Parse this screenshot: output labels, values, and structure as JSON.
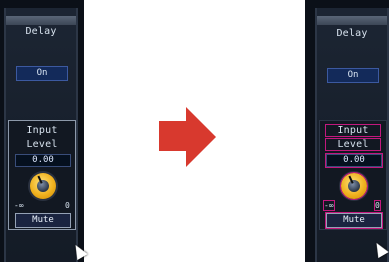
{
  "left_panel": {
    "section_title": "Delay",
    "delay_button": "On",
    "input_label_1": "Input",
    "input_label_2": "Level",
    "value": "0.00",
    "scale_min": "-∞",
    "scale_max": "0",
    "mute_button": "Mute"
  },
  "right_panel": {
    "section_title": "Delay",
    "delay_button": "On",
    "input_label_1": "Input",
    "input_label_2": "Level",
    "value": "0.00",
    "scale_min": "-∞",
    "scale_max": "0",
    "mute_button": "Mute"
  },
  "icons": {
    "transition_arrow": "right-arrow-icon",
    "pointer": "mouse-cursor-icon",
    "knob": "knob-icon"
  },
  "colors": {
    "arrow": "#d8392e",
    "highlight": "#c2187d",
    "strip_background": "#0b1018"
  }
}
